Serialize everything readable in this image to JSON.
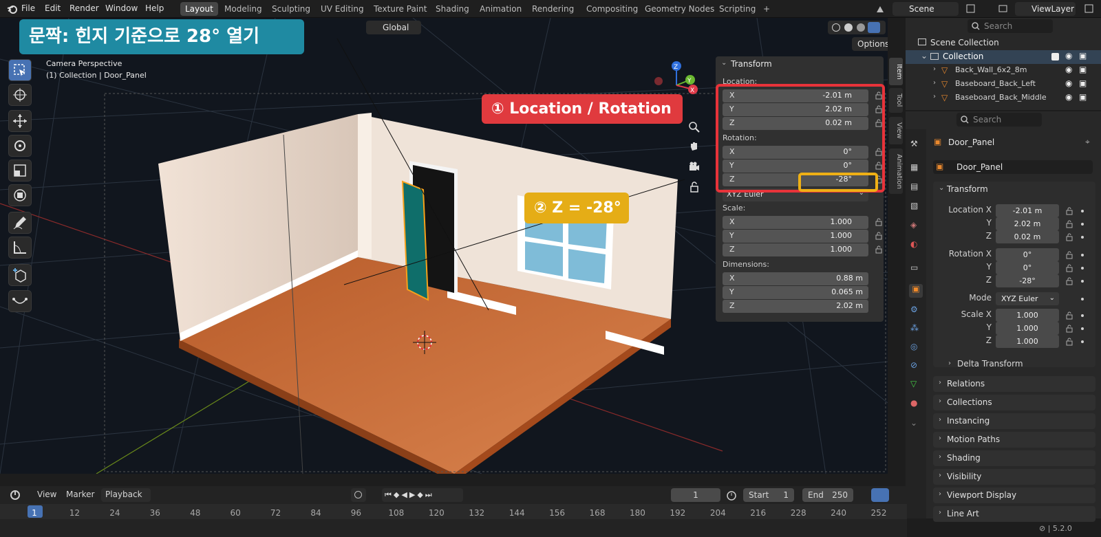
{
  "menus": [
    "File",
    "Edit",
    "Render",
    "Window",
    "Help"
  ],
  "workspaces": [
    "Layout",
    "Modeling",
    "Sculpting",
    "UV Editing",
    "Texture Paint",
    "Shading",
    "Animation",
    "Rendering",
    "Compositing",
    "Geometry Nodes",
    "Scripting"
  ],
  "add_tab": "+",
  "scene": "Scene",
  "view_layer": "ViewLayer",
  "header": {
    "orientation": "Global",
    "options": "Options"
  },
  "viewport": {
    "camera": "Camera Perspective",
    "collection_path": "(1) Collection | Door_Panel"
  },
  "side_tabs": [
    "Item",
    "Tool",
    "View",
    "Animation"
  ],
  "gizmo": {
    "x": "X",
    "y": "Y",
    "z": "Z"
  },
  "npanel": {
    "title": "Transform",
    "location_label": "Location:",
    "rotation_label": "Rotation:",
    "scale_label": "Scale:",
    "dimensions_label": "Dimensions:",
    "mode": "XYZ Euler",
    "location": [
      {
        "axis": "X",
        "value": "-2.01 m"
      },
      {
        "axis": "Y",
        "value": "2.02 m"
      },
      {
        "axis": "Z",
        "value": "0.02 m"
      }
    ],
    "rotation": [
      {
        "axis": "X",
        "value": "0°"
      },
      {
        "axis": "Y",
        "value": "0°"
      },
      {
        "axis": "Z",
        "value": "-28°"
      }
    ],
    "scale": [
      {
        "axis": "X",
        "value": "1.000"
      },
      {
        "axis": "Y",
        "value": "1.000"
      },
      {
        "axis": "Z",
        "value": "1.000"
      }
    ],
    "dimensions": [
      {
        "axis": "X",
        "value": "0.88 m"
      },
      {
        "axis": "Y",
        "value": "0.065 m"
      },
      {
        "axis": "Z",
        "value": "2.02 m"
      }
    ]
  },
  "annotations": {
    "title": "문짝: 힌지 기준으로 28° 열기",
    "label1": "① Location / Rotation",
    "label2": "② Z = -28°"
  },
  "outliner": {
    "search_placeholder": "Search",
    "scene_collection": "Scene Collection",
    "collection": "Collection",
    "items": [
      "Back_Wall_6x2_8m",
      "Baseboard_Back_Left",
      "Baseboard_Back_Middle"
    ]
  },
  "properties": {
    "search_placeholder": "Search",
    "object_name": "Door_Panel",
    "object_field": "Door_Panel",
    "transform": "Transform",
    "location_x_label": "Location X",
    "rotation_x_label": "Rotation X",
    "y_label": "Y",
    "z_label": "Z",
    "location": [
      "-2.01 m",
      "2.02 m",
      "0.02 m"
    ],
    "rotation": [
      "0°",
      "0°",
      "-28°"
    ],
    "mode_label": "Mode",
    "mode": "XYZ Euler",
    "scale_x_label": "Scale X",
    "scale": [
      "1.000",
      "1.000",
      "1.000"
    ],
    "delta": "Delta Transform",
    "sections": [
      "Relations",
      "Collections",
      "Instancing",
      "Motion Paths",
      "Shading",
      "Visibility",
      "Viewport Display",
      "Line Art"
    ]
  },
  "timeline": {
    "view": "View",
    "marker": "Marker",
    "playback": "Playback",
    "current_frame": "1",
    "start_label": "Start",
    "start": "1",
    "end_label": "End",
    "end": "250",
    "frames": [
      "1",
      "12",
      "24",
      "36",
      "48",
      "60",
      "72",
      "84",
      "96",
      "108",
      "120",
      "132",
      "144",
      "156",
      "168",
      "180",
      "192",
      "204",
      "216",
      "228",
      "240",
      "252"
    ]
  },
  "version": "5.2.0"
}
